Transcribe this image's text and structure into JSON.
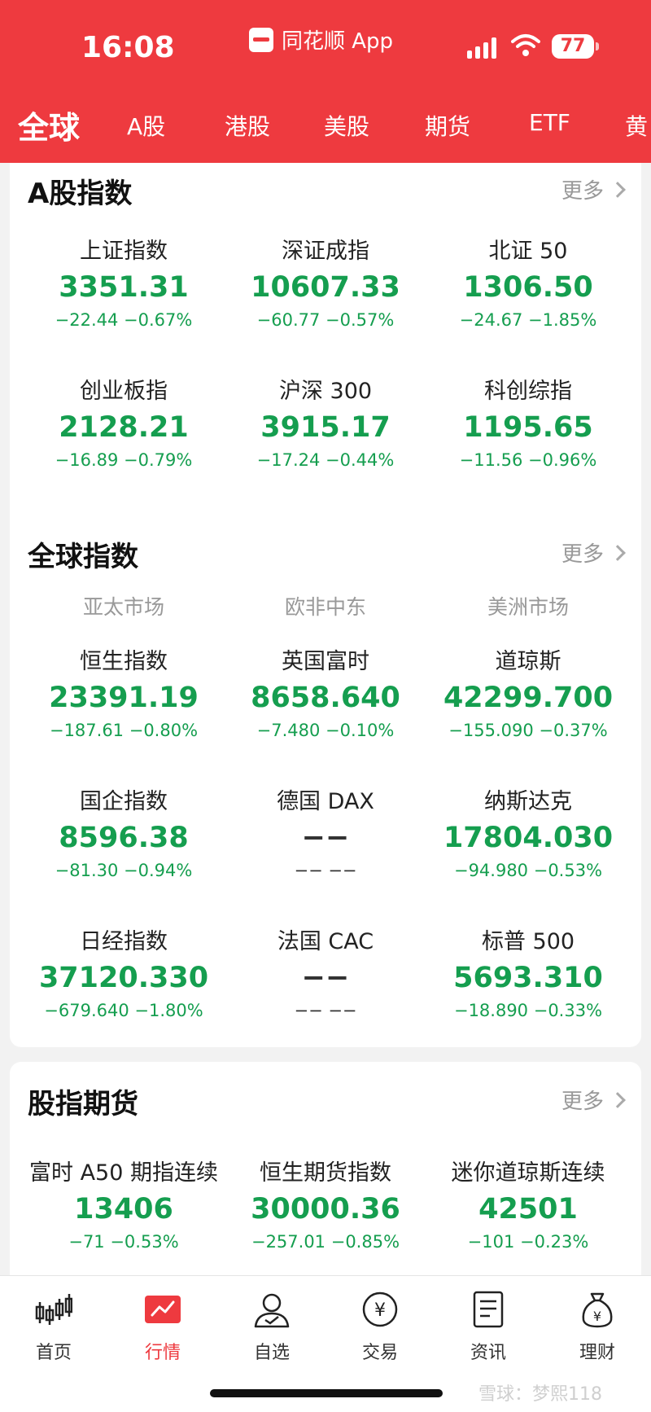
{
  "status_bar": {
    "time": "16:08",
    "app_name": "同花顺 App",
    "battery": "77"
  },
  "tabs": [
    {
      "label": "全球",
      "active": true
    },
    {
      "label": "A股"
    },
    {
      "label": "港股"
    },
    {
      "label": "美股"
    },
    {
      "label": "期货"
    },
    {
      "label": "ETF"
    },
    {
      "label": "黄"
    }
  ],
  "a_share": {
    "title": "A股指数",
    "more": "更多",
    "quotes": [
      {
        "name": "上证指数",
        "value": "3351.31",
        "change": "−22.44  −0.67%"
      },
      {
        "name": "深证成指",
        "value": "10607.33",
        "change": "−60.77  −0.57%"
      },
      {
        "name": "北证 50",
        "value": "1306.50",
        "change": "−24.67  −1.85%"
      },
      {
        "name": "创业板指",
        "value": "2128.21",
        "change": "−16.89  −0.79%"
      },
      {
        "name": "沪深 300",
        "value": "3915.17",
        "change": "−17.24  −0.44%"
      },
      {
        "name": "科创综指",
        "value": "1195.65",
        "change": "−11.56  −0.96%"
      }
    ]
  },
  "global": {
    "title": "全球指数",
    "more": "更多",
    "regions": [
      "亚太市场",
      "欧非中东",
      "美洲市场"
    ],
    "quotes": [
      {
        "name": "恒生指数",
        "value": "23391.19",
        "change": "−187.61  −0.80%"
      },
      {
        "name": "英国富时",
        "value": "8658.640",
        "change": "−7.480  −0.10%"
      },
      {
        "name": "道琼斯",
        "value": "42299.700",
        "change": "−155.090  −0.37%"
      },
      {
        "name": "国企指数",
        "value": "8596.38",
        "change": "−81.30  −0.94%"
      },
      {
        "name": "德国 DAX",
        "value": "−−",
        "change": "−−  −−"
      },
      {
        "name": "纳斯达克",
        "value": "17804.030",
        "change": "−94.980  −0.53%"
      },
      {
        "name": "日经指数",
        "value": "37120.330",
        "change": "−679.640  −1.80%"
      },
      {
        "name": "法国 CAC",
        "value": "−−",
        "change": "−−  −−"
      },
      {
        "name": "标普 500",
        "value": "5693.310",
        "change": "−18.890  −0.33%"
      }
    ]
  },
  "futures": {
    "title": "股指期货",
    "more": "更多",
    "quotes": [
      {
        "name": "富时 A50 期指连续",
        "value": "13406",
        "change": "−71  −0.53%"
      },
      {
        "name": "恒生期货指数",
        "value": "30000.36",
        "change": "−257.01  −0.85%"
      },
      {
        "name": "迷你道琼斯连续",
        "value": "42501",
        "change": "−101  −0.23%"
      }
    ]
  },
  "bottom_nav": [
    {
      "label": "首页",
      "icon": "candlestick-icon"
    },
    {
      "label": "行情",
      "icon": "chart-icon",
      "active": true
    },
    {
      "label": "自选",
      "icon": "user-icon"
    },
    {
      "label": "交易",
      "icon": "yen-icon"
    },
    {
      "label": "资讯",
      "icon": "news-icon"
    },
    {
      "label": "理财",
      "icon": "money-bag-icon"
    }
  ],
  "watermark": "雪球：梦熙118",
  "colors": {
    "brand_red": "#ee3a3f",
    "down_green": "#159e4f"
  }
}
